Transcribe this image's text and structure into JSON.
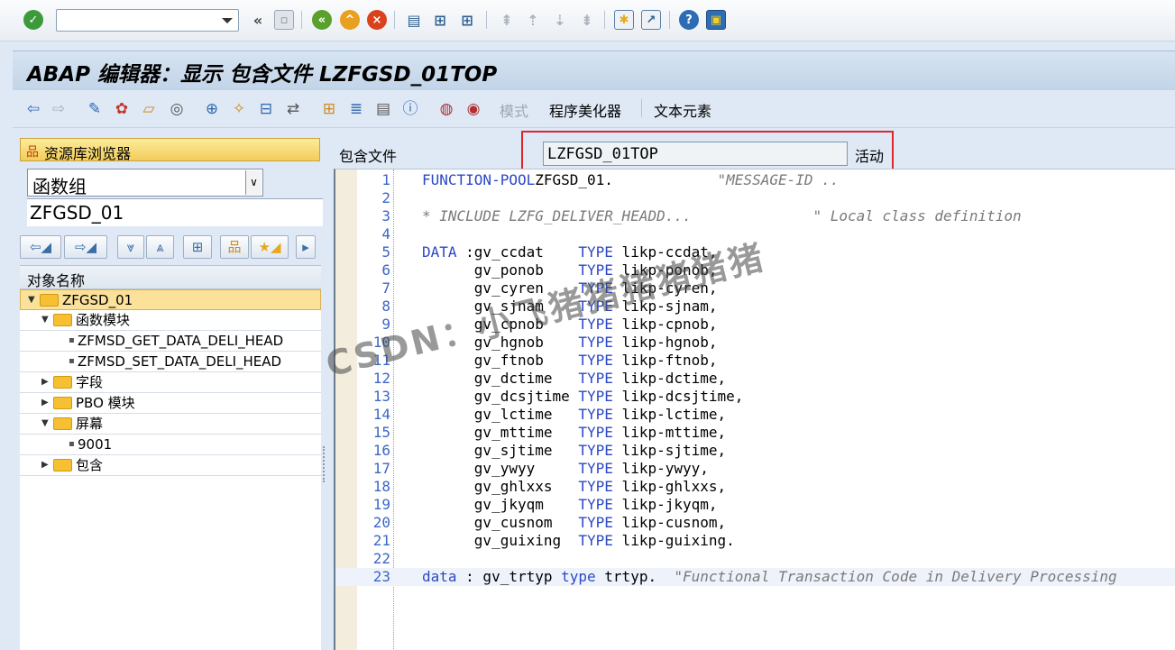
{
  "toolbar": {
    "command_value": "",
    "icons": [
      "enter-check-icon",
      "command-field",
      "collapse-icon",
      "save-icon",
      "back-icon",
      "exit-icon",
      "cancel-icon",
      "print-icon",
      "find-icon",
      "find-next-icon",
      "first-page-icon",
      "prev-page-icon",
      "next-page-icon",
      "last-page-icon",
      "create-session-icon",
      "shortcut-icon",
      "help-icon",
      "customize-layout-icon"
    ]
  },
  "title": "ABAP 编辑器：显示 包含文件 LZFGSD_01TOP",
  "app_toolbar": {
    "pattern_label": "模式",
    "pretty_printer_label": "程序美化器",
    "text_elements_label": "文本元素"
  },
  "left_panel": {
    "repo_browser_label": "资源库浏览器",
    "object_type": "函数组",
    "object_name": "ZFGSD_01",
    "tree_header": "对象名称",
    "tree": [
      {
        "label": "ZFGSD_01",
        "level": 0,
        "expanded": true,
        "folder": true,
        "selected": true
      },
      {
        "label": "函数模块",
        "level": 1,
        "expanded": true,
        "folder": true
      },
      {
        "label": "ZFMSD_GET_DATA_DELI_HEAD",
        "level": 2,
        "leaf": true
      },
      {
        "label": "ZFMSD_SET_DATA_DELI_HEAD",
        "level": 2,
        "leaf": true
      },
      {
        "label": "字段",
        "level": 1,
        "expanded": false,
        "folder": true
      },
      {
        "label": "PBO 模块",
        "level": 1,
        "expanded": false,
        "folder": true
      },
      {
        "label": "屏幕",
        "level": 1,
        "expanded": true,
        "folder": true
      },
      {
        "label": "9001",
        "level": 2,
        "leaf": true
      },
      {
        "label": "包含",
        "level": 1,
        "expanded": false,
        "folder": true
      }
    ]
  },
  "include": {
    "label": "包含文件",
    "name": "LZFGSD_01TOP",
    "status": "活动"
  },
  "code_lines": [
    {
      "n": "1",
      "parts": [
        [
          "kw",
          "FUNCTION-POOL"
        ],
        [
          "",
          "ZFGSD_01."
        ],
        [
          "sp",
          "            "
        ],
        [
          "cm",
          "\"MESSAGE-ID .."
        ]
      ]
    },
    {
      "n": "2",
      "parts": []
    },
    {
      "n": "3",
      "parts": [
        [
          "cm",
          "* INCLUDE LZFG_DELIVER_HEADD...              \" Local class definition"
        ]
      ]
    },
    {
      "n": "4",
      "parts": []
    },
    {
      "n": "5",
      "parts": [
        [
          "kw",
          "DATA"
        ],
        [
          "",
          " :gv_ccdat    "
        ],
        [
          "kw",
          "TYPE"
        ],
        [
          "",
          " likp-ccdat,"
        ]
      ]
    },
    {
      "n": "6",
      "parts": [
        [
          "",
          "      gv_ponob    "
        ],
        [
          "kw",
          "TYPE"
        ],
        [
          "",
          " likp-ponob,"
        ]
      ]
    },
    {
      "n": "7",
      "parts": [
        [
          "",
          "      gv_cyren    "
        ],
        [
          "kw",
          "TYPE"
        ],
        [
          "",
          " likp-cyren,"
        ]
      ]
    },
    {
      "n": "8",
      "parts": [
        [
          "",
          "      gv_sjnam    "
        ],
        [
          "kw",
          "TYPE"
        ],
        [
          "",
          " likp-sjnam,"
        ]
      ]
    },
    {
      "n": "9",
      "parts": [
        [
          "",
          "      gv_cpnob    "
        ],
        [
          "kw",
          "TYPE"
        ],
        [
          "",
          " likp-cpnob,"
        ]
      ]
    },
    {
      "n": "10",
      "parts": [
        [
          "",
          "      gv_hgnob    "
        ],
        [
          "kw",
          "TYPE"
        ],
        [
          "",
          " likp-hgnob,"
        ]
      ]
    },
    {
      "n": "11",
      "parts": [
        [
          "",
          "      gv_ftnob    "
        ],
        [
          "kw",
          "TYPE"
        ],
        [
          "",
          " likp-ftnob,"
        ]
      ]
    },
    {
      "n": "12",
      "parts": [
        [
          "",
          "      gv_dctime   "
        ],
        [
          "kw",
          "TYPE"
        ],
        [
          "",
          " likp-dctime,"
        ]
      ]
    },
    {
      "n": "13",
      "parts": [
        [
          "",
          "      gv_dcsjtime "
        ],
        [
          "kw",
          "TYPE"
        ],
        [
          "",
          " likp-dcsjtime,"
        ]
      ]
    },
    {
      "n": "14",
      "parts": [
        [
          "",
          "      gv_lctime   "
        ],
        [
          "kw",
          "TYPE"
        ],
        [
          "",
          " likp-lctime,"
        ]
      ]
    },
    {
      "n": "15",
      "parts": [
        [
          "",
          "      gv_mttime   "
        ],
        [
          "kw",
          "TYPE"
        ],
        [
          "",
          " likp-mttime,"
        ]
      ]
    },
    {
      "n": "16",
      "parts": [
        [
          "",
          "      gv_sjtime   "
        ],
        [
          "kw",
          "TYPE"
        ],
        [
          "",
          " likp-sjtime,"
        ]
      ]
    },
    {
      "n": "17",
      "parts": [
        [
          "",
          "      gv_ywyy     "
        ],
        [
          "kw",
          "TYPE"
        ],
        [
          "",
          " likp-ywyy,"
        ]
      ]
    },
    {
      "n": "18",
      "parts": [
        [
          "",
          "      gv_ghlxxs   "
        ],
        [
          "kw",
          "TYPE"
        ],
        [
          "",
          " likp-ghlxxs,"
        ]
      ]
    },
    {
      "n": "19",
      "parts": [
        [
          "",
          "      gv_jkyqm    "
        ],
        [
          "kw",
          "TYPE"
        ],
        [
          "",
          " likp-jkyqm,"
        ]
      ]
    },
    {
      "n": "20",
      "parts": [
        [
          "",
          "      gv_cusnom   "
        ],
        [
          "kw",
          "TYPE"
        ],
        [
          "",
          " likp-cusnom,"
        ]
      ]
    },
    {
      "n": "21",
      "parts": [
        [
          "",
          "      gv_guixing  "
        ],
        [
          "kw",
          "TYPE"
        ],
        [
          "",
          " likp-guixing."
        ]
      ]
    },
    {
      "n": "22",
      "parts": []
    },
    {
      "n": "23",
      "parts": [
        [
          "kw",
          "data"
        ],
        [
          "",
          " : gv_trtyp "
        ],
        [
          "kw",
          "type"
        ],
        [
          "",
          " trtyp.  "
        ],
        [
          "cm",
          "\"Functional Transaction Code in Delivery Processing"
        ]
      ]
    }
  ],
  "watermark": "CSDN：小飞猪猪猪猪猪猪",
  "colors": {
    "keyword": "#2b48c6",
    "comment": "#7a7a7a",
    "line_number": "#3a66c8",
    "highlight": "#e0252b",
    "selected_node": "#fce19b"
  }
}
